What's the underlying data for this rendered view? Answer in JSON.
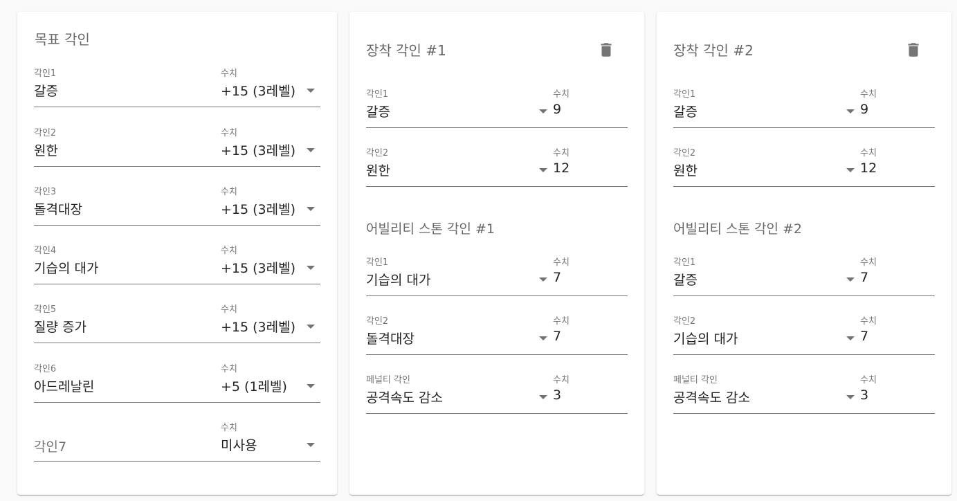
{
  "target": {
    "title": "목표 각인",
    "rows": [
      {
        "label": "각인1",
        "value": "갈증",
        "level_label": "수치",
        "level": "+15 (3레벨)"
      },
      {
        "label": "각인2",
        "value": "원한",
        "level_label": "수치",
        "level": "+15 (3레벨)"
      },
      {
        "label": "각인3",
        "value": "돌격대장",
        "level_label": "수치",
        "level": "+15 (3레벨)"
      },
      {
        "label": "각인4",
        "value": "기습의 대가",
        "level_label": "수치",
        "level": "+15 (3레벨)"
      },
      {
        "label": "각인5",
        "value": "질량 증가",
        "level_label": "수치",
        "level": "+15 (3레벨)"
      },
      {
        "label": "각인6",
        "value": "아드레날린",
        "level_label": "수치",
        "level": "+5 (1레벨)"
      },
      {
        "placeholder": "각인7",
        "level_label": "수치",
        "level": "미사용"
      }
    ]
  },
  "equip": [
    {
      "title": "장착 각인 #1",
      "rows": [
        {
          "label": "각인1",
          "value": "갈증",
          "num_label": "수치",
          "num": "9"
        },
        {
          "label": "각인2",
          "value": "원한",
          "num_label": "수치",
          "num": "12"
        }
      ],
      "stone_title": "어빌리티 스톤 각인 #1",
      "stone_rows": [
        {
          "label": "각인1",
          "value": "기습의 대가",
          "num_label": "수치",
          "num": "7"
        },
        {
          "label": "각인2",
          "value": "돌격대장",
          "num_label": "수치",
          "num": "7"
        },
        {
          "label": "페널티 각인",
          "value": "공격속도 감소",
          "num_label": "수치",
          "num": "3"
        }
      ]
    },
    {
      "title": "장착 각인 #2",
      "rows": [
        {
          "label": "각인1",
          "value": "갈증",
          "num_label": "수치",
          "num": "9"
        },
        {
          "label": "각인2",
          "value": "원한",
          "num_label": "수치",
          "num": "12"
        }
      ],
      "stone_title": "어빌리티 스톤 각인 #2",
      "stone_rows": [
        {
          "label": "각인1",
          "value": "갈증",
          "num_label": "수치",
          "num": "7"
        },
        {
          "label": "각인2",
          "value": "기습의 대가",
          "num_label": "수치",
          "num": "7"
        },
        {
          "label": "페널티 각인",
          "value": "공격속도 감소",
          "num_label": "수치",
          "num": "3"
        }
      ]
    }
  ],
  "icons": {
    "delete": "trash-icon",
    "dropdown": "arrow-drop-down-icon"
  }
}
